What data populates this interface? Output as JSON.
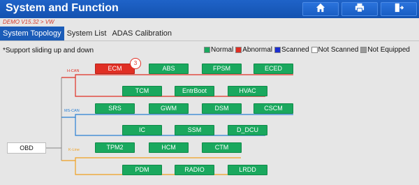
{
  "header": {
    "title": "System and Function",
    "buttons": [
      {
        "icon": "home-icon"
      },
      {
        "icon": "print-icon"
      },
      {
        "icon": "exit-icon"
      }
    ]
  },
  "version_path": "DEMO V15.32 > VW",
  "tabs": [
    {
      "label": "System Topology",
      "active": true
    },
    {
      "label": "System List",
      "active": false
    },
    {
      "label": "ADAS Calibration",
      "active": false
    }
  ],
  "note": "*Support sliding up and down",
  "legend": [
    {
      "label": "Normal",
      "color": "#1aa85e"
    },
    {
      "label": "Abnormal",
      "color": "#e02f24"
    },
    {
      "label": "Scanned",
      "color": "#1c2fd0"
    },
    {
      "label": "Not Scanned",
      "color": "#ffffff"
    },
    {
      "label": "Not Equipped",
      "color": "#9a9a9a"
    }
  ],
  "topology": {
    "root": "OBD",
    "buses": [
      {
        "name": "H-CAN",
        "color": "#e02f24"
      },
      {
        "name": "MS-CAN",
        "color": "#2a7fd4"
      },
      {
        "name": "K-Line",
        "color": "#f0a020"
      }
    ],
    "modules": [
      {
        "name": "ECM",
        "status": "Abnormal",
        "bus": "H-CAN",
        "fault_count": "3"
      },
      {
        "name": "ABS",
        "status": "Normal",
        "bus": "H-CAN"
      },
      {
        "name": "FPSM",
        "status": "Normal",
        "bus": "H-CAN"
      },
      {
        "name": "ECED",
        "status": "Normal",
        "bus": "H-CAN"
      },
      {
        "name": "TCM",
        "status": "Normal",
        "bus": "H-CAN"
      },
      {
        "name": "EntrBoot",
        "status": "Normal",
        "bus": "H-CAN"
      },
      {
        "name": "HVAC",
        "status": "Normal",
        "bus": "H-CAN"
      },
      {
        "name": "SRS",
        "status": "Normal",
        "bus": "MS-CAN"
      },
      {
        "name": "GWM",
        "status": "Normal",
        "bus": "MS-CAN"
      },
      {
        "name": "DSM",
        "status": "Normal",
        "bus": "MS-CAN"
      },
      {
        "name": "CSCM",
        "status": "Normal",
        "bus": "MS-CAN"
      },
      {
        "name": "IC",
        "status": "Normal",
        "bus": "MS-CAN"
      },
      {
        "name": "SSM",
        "status": "Normal",
        "bus": "MS-CAN"
      },
      {
        "name": "D_DCU",
        "status": "Normal",
        "bus": "MS-CAN"
      },
      {
        "name": "TPM2",
        "status": "Normal",
        "bus": "K-Line"
      },
      {
        "name": "HCM",
        "status": "Normal",
        "bus": "K-Line"
      },
      {
        "name": "CTM",
        "status": "Normal",
        "bus": "K-Line"
      },
      {
        "name": "PDM",
        "status": "Normal",
        "bus": "K-Line"
      },
      {
        "name": "RADIO",
        "status": "Normal",
        "bus": "K-Line"
      },
      {
        "name": "LRDD",
        "status": "Normal",
        "bus": "K-Line"
      }
    ]
  }
}
